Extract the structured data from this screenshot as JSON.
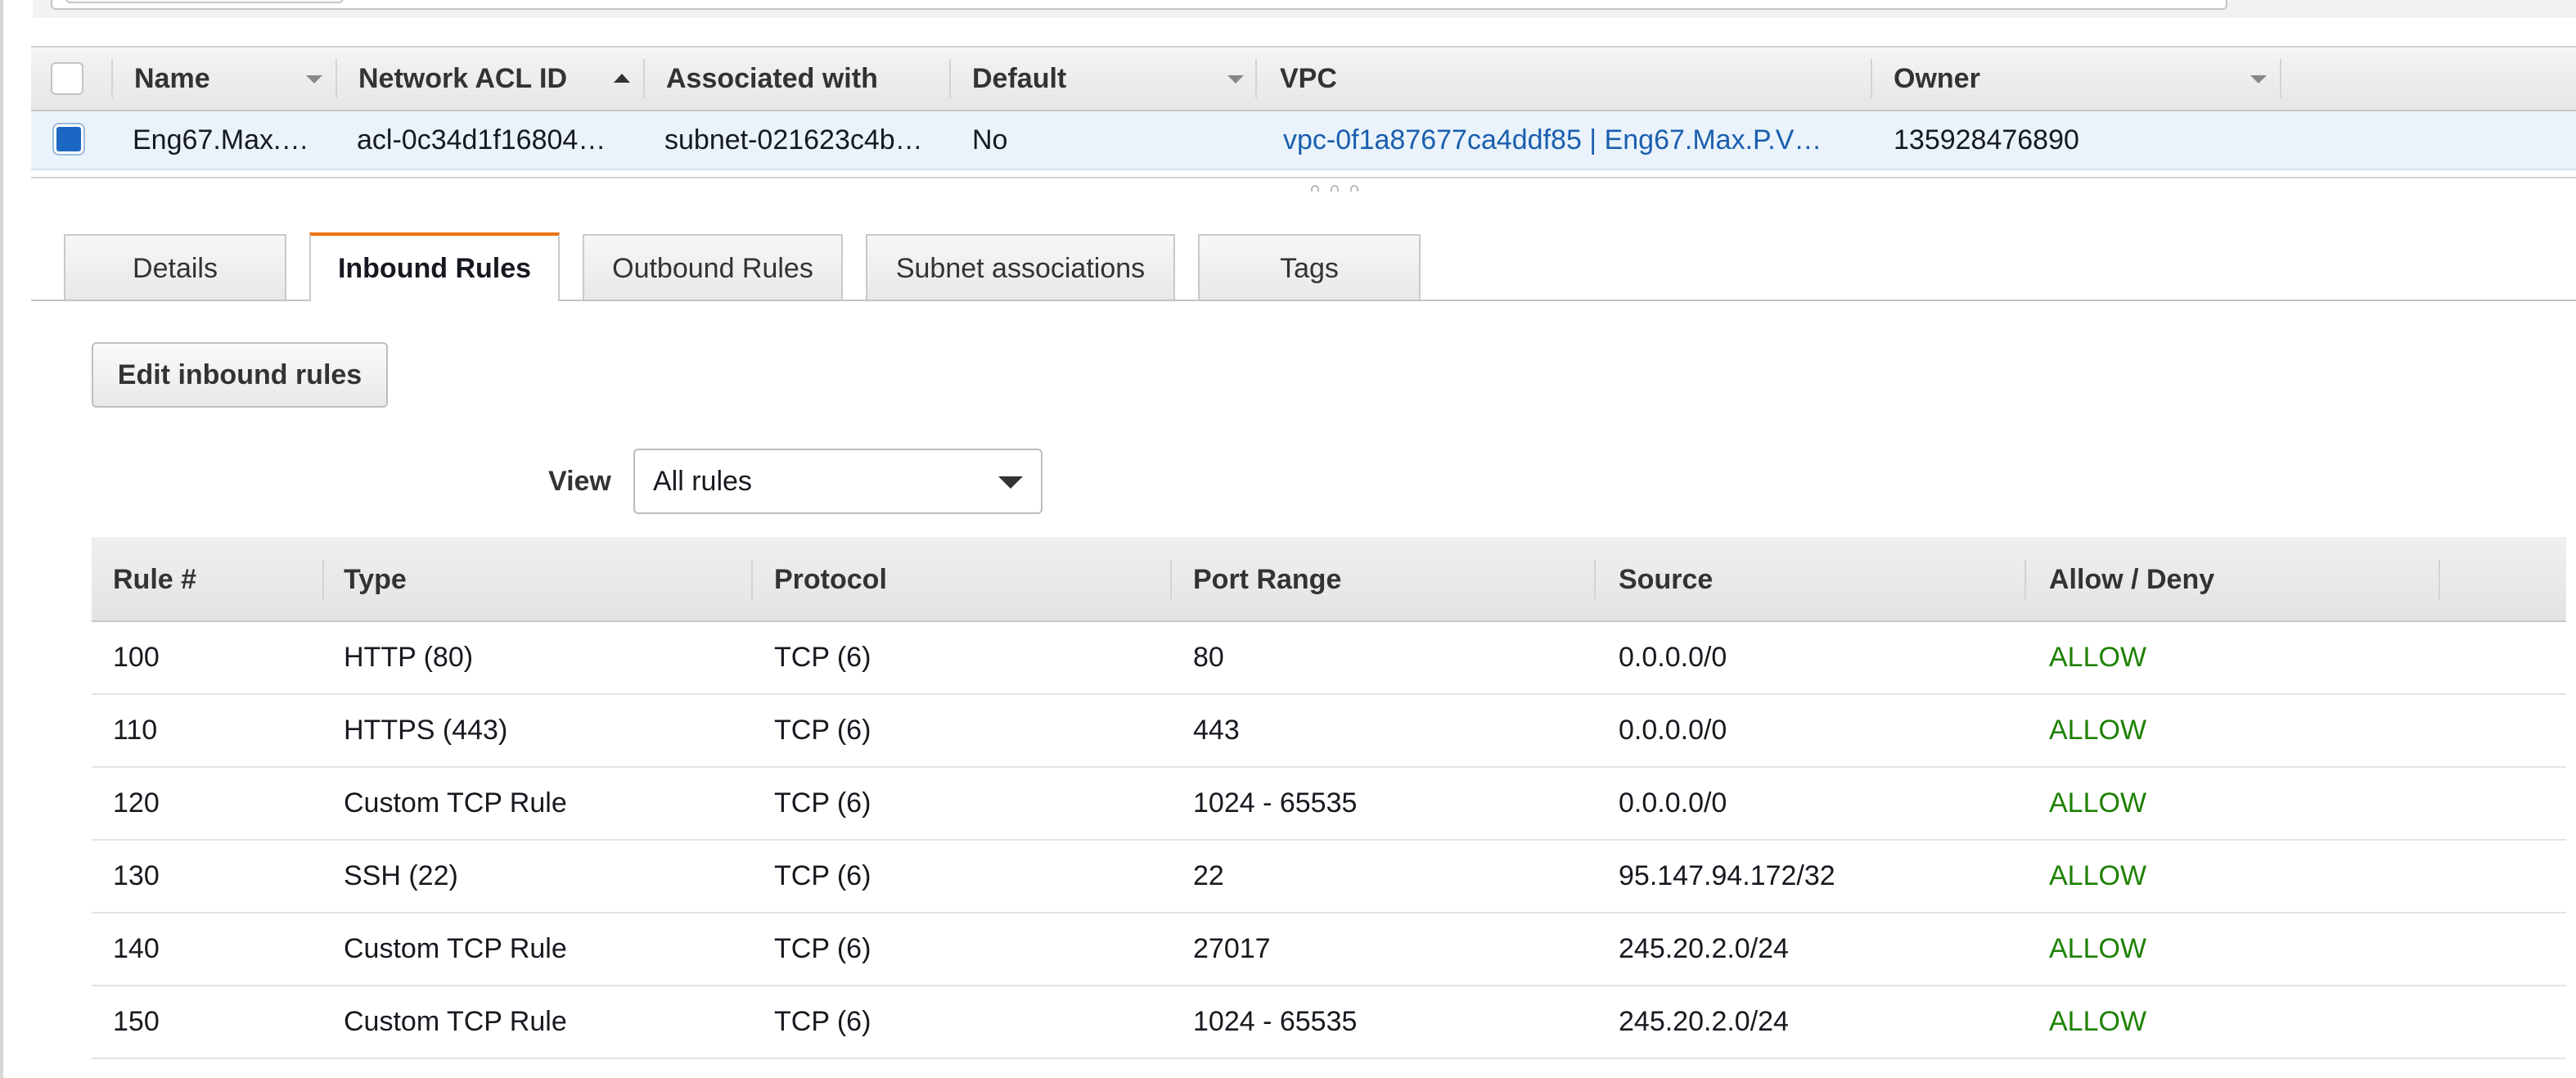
{
  "acl_table": {
    "headers": [
      "Name",
      "Network ACL ID",
      "Associated with",
      "Default",
      "VPC",
      "Owner"
    ],
    "row": {
      "name": "Eng67.Max.…",
      "network_acl_id": "acl-0c34d1f16804…",
      "associated_with": "subnet-021623c4b…",
      "default": "No",
      "vpc": "vpc-0f1a87677ca4ddf85 | Eng67.Max.P.V…",
      "owner": "135928476890",
      "selected": true
    }
  },
  "tabs": [
    {
      "label": "Details",
      "active": false
    },
    {
      "label": "Inbound Rules",
      "active": true
    },
    {
      "label": "Outbound Rules",
      "active": false
    },
    {
      "label": "Subnet associations",
      "active": false
    },
    {
      "label": "Tags",
      "active": false
    }
  ],
  "edit_button_label": "Edit inbound rules",
  "view": {
    "label": "View",
    "selected": "All rules"
  },
  "rules_table": {
    "headers": [
      "Rule #",
      "Type",
      "Protocol",
      "Port Range",
      "Source",
      "Allow / Deny"
    ],
    "rows": [
      {
        "rule": "100",
        "type": "HTTP (80)",
        "protocol": "TCP (6)",
        "port_range": "80",
        "source": "0.0.0.0/0",
        "action": "ALLOW"
      },
      {
        "rule": "110",
        "type": "HTTPS (443)",
        "protocol": "TCP (6)",
        "port_range": "443",
        "source": "0.0.0.0/0",
        "action": "ALLOW"
      },
      {
        "rule": "120",
        "type": "Custom TCP Rule",
        "protocol": "TCP (6)",
        "port_range": "1024 - 65535",
        "source": "0.0.0.0/0",
        "action": "ALLOW"
      },
      {
        "rule": "130",
        "type": "SSH (22)",
        "protocol": "TCP (6)",
        "port_range": "22",
        "source": "95.147.94.172/32",
        "action": "ALLOW"
      },
      {
        "rule": "140",
        "type": "Custom TCP Rule",
        "protocol": "TCP (6)",
        "port_range": "27017",
        "source": "245.20.2.0/24",
        "action": "ALLOW"
      },
      {
        "rule": "150",
        "type": "Custom TCP Rule",
        "protocol": "TCP (6)",
        "port_range": "1024 - 65535",
        "source": "245.20.2.0/24",
        "action": "ALLOW"
      }
    ]
  },
  "colors": {
    "accent_tab": "#ec7211",
    "selected_checkbox": "#1b67c4",
    "link": "#1a5fae",
    "allow": "#1d8102",
    "selected_row": "#eaf3fb"
  }
}
